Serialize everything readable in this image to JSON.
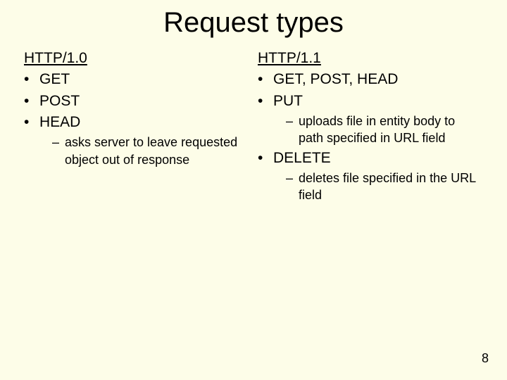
{
  "title": "Request types",
  "left": {
    "header": "HTTP/1.0",
    "items": [
      {
        "label": "GET"
      },
      {
        "label": "POST"
      },
      {
        "label": "HEAD",
        "sub": [
          "asks server to leave requested object out of response"
        ]
      }
    ]
  },
  "right": {
    "header": "HTTP/1.1",
    "items": [
      {
        "label": "GET, POST, HEAD"
      },
      {
        "label": "PUT",
        "sub": [
          "uploads file in entity body to path specified in URL field"
        ]
      },
      {
        "label": "DELETE",
        "sub": [
          "deletes file specified in the URL field"
        ]
      }
    ]
  },
  "page_number": "8",
  "glyphs": {
    "bullet": "•",
    "dash": "–"
  }
}
